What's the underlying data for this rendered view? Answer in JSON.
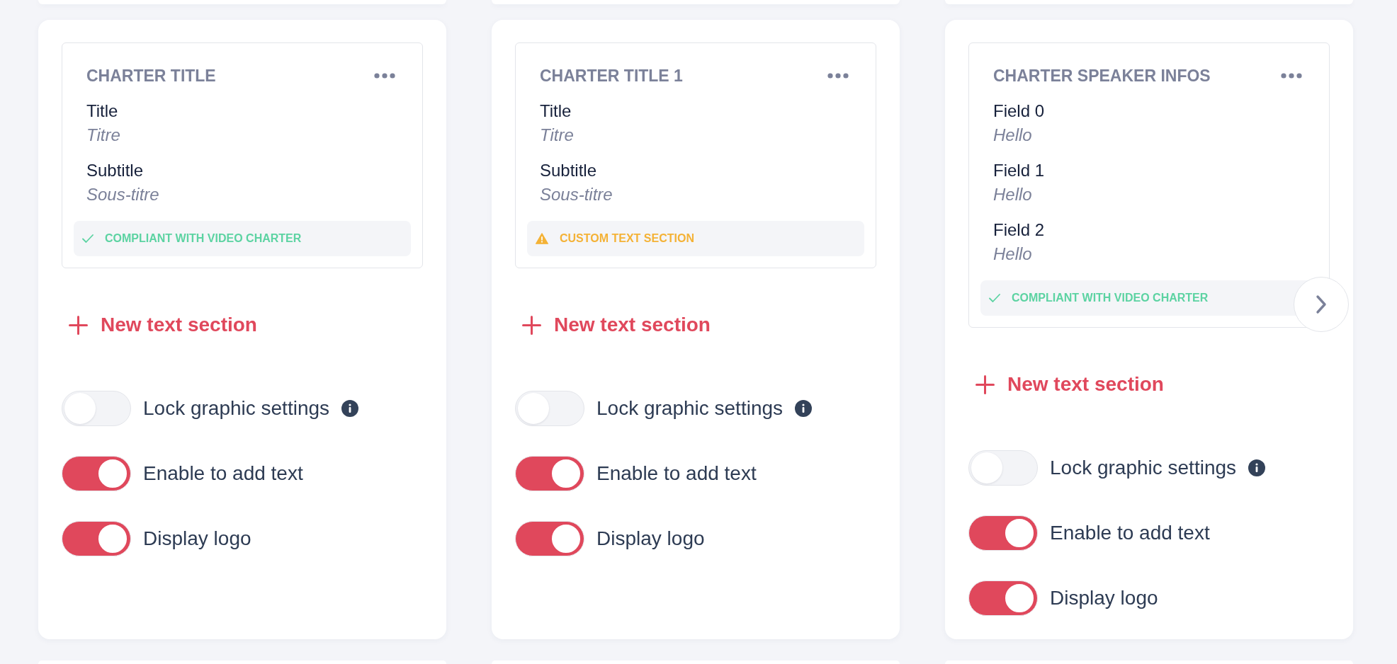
{
  "cards": [
    {
      "title": "CHARTER TITLE",
      "fields": [
        {
          "label": "Title",
          "value": "Titre"
        },
        {
          "label": "Subtitle",
          "value": "Sous-titre"
        }
      ],
      "status": {
        "kind": "compliant",
        "text": "COMPLIANT WITH VIDEO CHARTER"
      },
      "add_label": "New text section",
      "scroll_arrow": false,
      "toggles": [
        {
          "label": "Lock graphic settings",
          "on": false,
          "info": true
        },
        {
          "label": "Enable to add text",
          "on": true,
          "info": false
        },
        {
          "label": "Display logo",
          "on": true,
          "info": false
        }
      ]
    },
    {
      "title": "CHARTER TITLE 1",
      "fields": [
        {
          "label": "Title",
          "value": "Titre"
        },
        {
          "label": "Subtitle",
          "value": "Sous-titre"
        }
      ],
      "status": {
        "kind": "custom",
        "text": "CUSTOM TEXT SECTION"
      },
      "add_label": "New text section",
      "scroll_arrow": false,
      "toggles": [
        {
          "label": "Lock graphic settings",
          "on": false,
          "info": true
        },
        {
          "label": "Enable to add text",
          "on": true,
          "info": false
        },
        {
          "label": "Display logo",
          "on": true,
          "info": false
        }
      ]
    },
    {
      "title": "CHARTER SPEAKER INFOS",
      "fields": [
        {
          "label": "Field 0",
          "value": "Hello"
        },
        {
          "label": "Field 1",
          "value": "Hello"
        },
        {
          "label": "Field 2",
          "value": "Hello"
        }
      ],
      "status": {
        "kind": "compliant",
        "text": "COMPLIANT WITH VIDEO CHARTER"
      },
      "add_label": "New text section",
      "scroll_arrow": true,
      "toggles": [
        {
          "label": "Lock graphic settings",
          "on": false,
          "info": true
        },
        {
          "label": "Enable to add text",
          "on": true,
          "info": false
        },
        {
          "label": "Display logo",
          "on": true,
          "info": false
        }
      ]
    }
  ]
}
